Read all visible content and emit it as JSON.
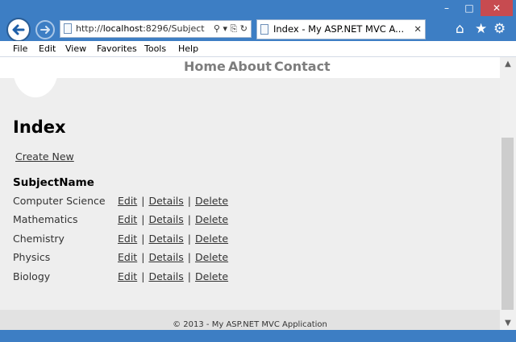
{
  "window": {
    "controls": {
      "minimize": "–",
      "maximize": "□",
      "close": "✕"
    }
  },
  "browser": {
    "address_prefix": "http://",
    "address_host": "localhost",
    "address_rest": ":8296/Subject",
    "address_tools": "⚲ ▾ ⎘ ↻",
    "tab_title": "Index - My ASP.NET MVC A...",
    "tab_close": "✕",
    "icons": {
      "home": "⌂",
      "favorites": "★",
      "settings": "⚙"
    }
  },
  "menubar": {
    "items": [
      "File",
      "Edit",
      "View",
      "Favorites",
      "Tools",
      "Help"
    ]
  },
  "site": {
    "nav": [
      "Home",
      "About",
      "Contact"
    ],
    "page_title": "Index",
    "create_new": "Create New",
    "column_header": "SubjectName",
    "rows": [
      {
        "name": "Computer Science"
      },
      {
        "name": "Mathematics"
      },
      {
        "name": "Chemistry"
      },
      {
        "name": "Physics"
      },
      {
        "name": "Biology"
      }
    ],
    "actions": {
      "edit": "Edit",
      "details": "Details",
      "delete": "Delete",
      "separator": "|"
    },
    "footer": "© 2013 - My ASP.NET MVC Application"
  },
  "scrollbar": {
    "up": "▲",
    "down": "▼"
  }
}
